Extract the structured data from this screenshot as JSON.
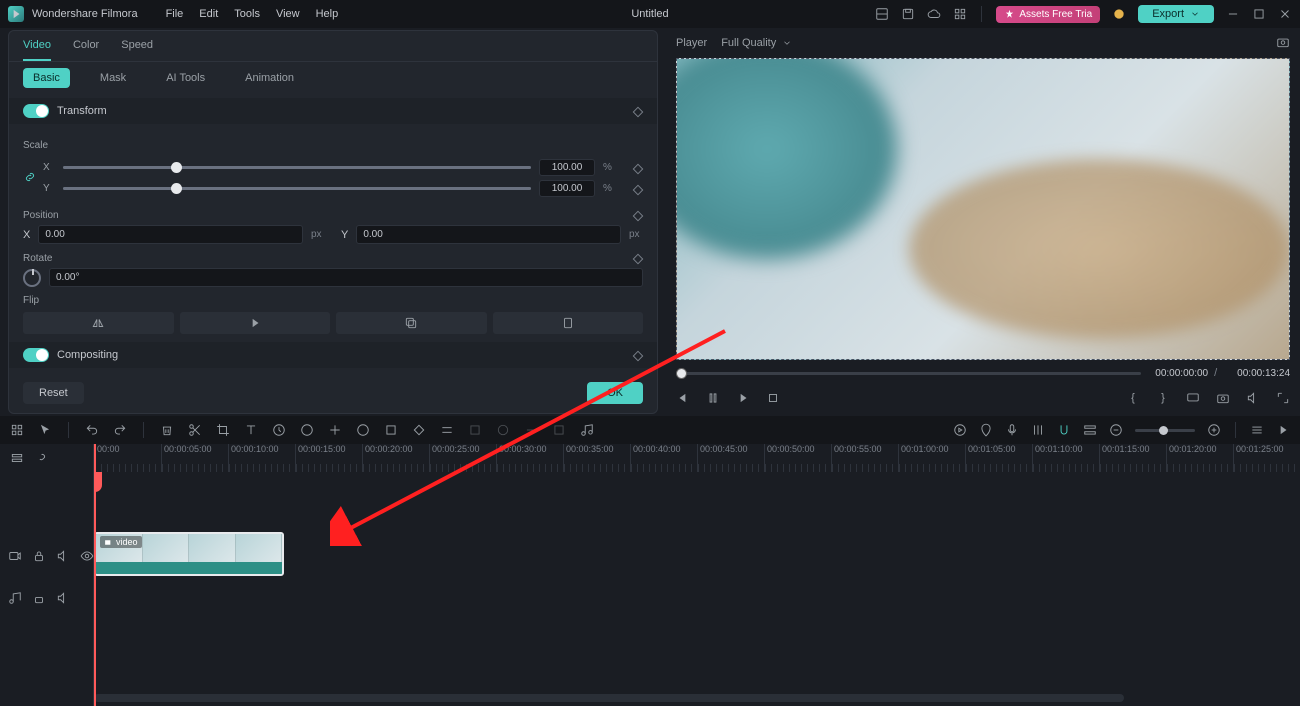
{
  "app": {
    "title": "Wondershare Filmora",
    "document": "Untitled"
  },
  "menu": {
    "file": "File",
    "edit": "Edit",
    "tools": "Tools",
    "view": "View",
    "help": "Help"
  },
  "titlebar_right": {
    "assets": "Assets Free Tria",
    "export": "Export"
  },
  "panel_tabs": {
    "video": "Video",
    "color": "Color",
    "speed": "Speed"
  },
  "subtabs": {
    "basic": "Basic",
    "mask": "Mask",
    "ai": "AI Tools",
    "animation": "Animation"
  },
  "transform": {
    "label": "Transform",
    "scale_label": "Scale",
    "scale_x": "100.00",
    "scale_y": "100.00",
    "unit_pct": "%",
    "position_label": "Position",
    "pos_x": "0.00",
    "pos_y": "0.00",
    "unit_px": "px",
    "rotate_label": "Rotate",
    "rotate_val": "0.00°",
    "flip_label": "Flip",
    "axis_x": "X",
    "axis_y": "Y"
  },
  "compositing": {
    "label": "Compositing"
  },
  "buttons": {
    "reset": "Reset",
    "ok": "OK"
  },
  "player": {
    "label": "Player",
    "quality": "Full Quality",
    "current": "00:00:00:00",
    "total": "00:00:13:24",
    "sep": "/"
  },
  "timeline": {
    "ticks": [
      "00:00",
      "00:00:05:00",
      "00:00:10:00",
      "00:00:15:00",
      "00:00:20:00",
      "00:00:25:00",
      "00:00:30:00",
      "00:00:35:00",
      "00:00:40:00",
      "00:00:45:00",
      "00:00:50:00",
      "00:00:55:00",
      "00:01:00:00",
      "00:01:05:00",
      "00:01:10:00",
      "00:01:15:00",
      "00:01:20:00",
      "00:01:25:00"
    ],
    "clip_label": "video"
  }
}
